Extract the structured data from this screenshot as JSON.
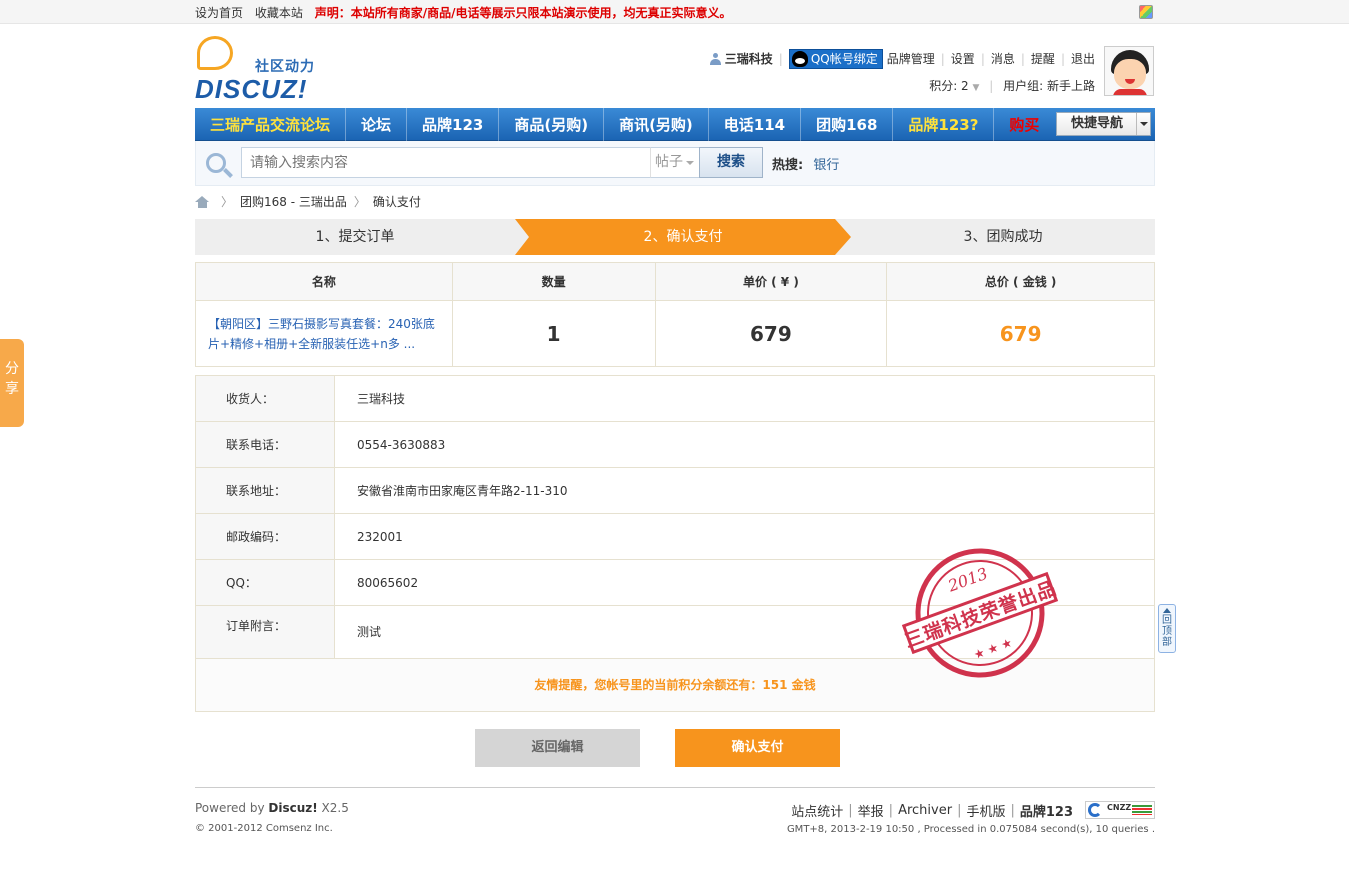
{
  "topbar": {
    "set_home": "设为首页",
    "bookmark": "收藏本站",
    "declaration": "声明：本站所有商家/商品/电话等展示只限本站演示使用，均无真正实际意义。"
  },
  "logo": {
    "slogan": "社区动力",
    "wordmark": "DISCUZ!"
  },
  "user": {
    "name": "三瑞科技",
    "qq_bind": "QQ帐号绑定",
    "links": [
      "品牌管理",
      "设置",
      "消息",
      "提醒",
      "退出"
    ],
    "points": "积分: 2",
    "group": "用户组: 新手上路"
  },
  "nav": {
    "items": [
      "三瑞产品交流论坛",
      "论坛",
      "品牌123",
      "商品(另购)",
      "商讯(另购)",
      "电话114",
      "团购168",
      "品牌123?",
      "购买"
    ],
    "quick_nav": "快捷导航"
  },
  "search": {
    "placeholder": "请输入搜索内容",
    "type": "帖子",
    "button": "搜索",
    "hot_label": "热搜:",
    "hot_keyword": "银行"
  },
  "breadcrumb": {
    "items": [
      "团购168 - 三瑞出品",
      "确认支付"
    ]
  },
  "steps": [
    "1、提交订单",
    "2、确认支付",
    "3、团购成功"
  ],
  "product_table": {
    "headers": [
      "名称",
      "数量",
      "单价 ( ¥ )",
      "总价 ( 金钱 )"
    ],
    "row": {
      "name": "【朝阳区】三野石摄影写真套餐：240张底片+精修+相册+全新服装任选+n多 ...",
      "quantity": "1",
      "unit_price": "679",
      "total": "679"
    }
  },
  "info": {
    "rows": [
      {
        "label": "收货人：",
        "value": "三瑞科技"
      },
      {
        "label": "联系电话：",
        "value": "0554-3630883"
      },
      {
        "label": "联系地址：",
        "value": "安徽省淮南市田家庵区青年路2-11-310"
      },
      {
        "label": "邮政编码：",
        "value": "232001"
      },
      {
        "label": "QQ：",
        "value": "80065602"
      },
      {
        "label": "订单附言：",
        "value": "测试"
      }
    ],
    "tip": "友情提醒，您帐号里的当前积分余额还有：151 金钱"
  },
  "stamp": {
    "year": "2013",
    "text": "三瑞科技荣誉出品"
  },
  "buttons": {
    "back": "返回编辑",
    "confirm": "确认支付"
  },
  "footer": {
    "powered_prefix": "Powered by ",
    "powered_brand": "Discuz!",
    "powered_version": " X2.5",
    "copyright": "© 2001-2012 Comsenz Inc.",
    "links": [
      "站点统计",
      "举报",
      "Archiver",
      "手机版",
      "品牌123"
    ],
    "cnzz": "CNZZ",
    "stats": "GMT+8, 2013-2-19 10:50 , Processed in 0.075084 second(s), 10 queries ."
  },
  "side": {
    "share": "分享",
    "back_top": "回顶部"
  }
}
